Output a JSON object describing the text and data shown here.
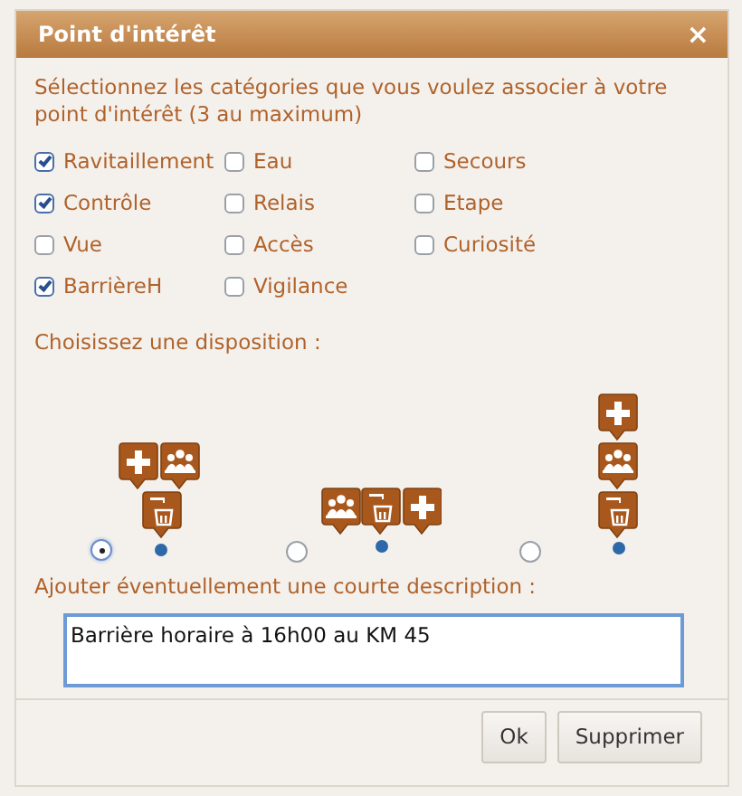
{
  "dialog": {
    "title": "Point d'intérêt",
    "close": "×"
  },
  "intro": "Sélectionnez les catégories que vous voulez associer à votre point d'intérêt (3 au maximum)",
  "categories": [
    {
      "label": "Ravitaillement",
      "checked": true
    },
    {
      "label": "Eau",
      "checked": false
    },
    {
      "label": "Secours",
      "checked": false
    },
    {
      "label": "Contrôle",
      "checked": true
    },
    {
      "label": "Relais",
      "checked": false
    },
    {
      "label": "Etape",
      "checked": false
    },
    {
      "label": "Vue",
      "checked": false
    },
    {
      "label": "Accès",
      "checked": false
    },
    {
      "label": "Curiosité",
      "checked": false
    },
    {
      "label": "BarrièreH",
      "checked": true
    },
    {
      "label": "Vigilance",
      "checked": false
    }
  ],
  "layout_prompt": "Choisissez une disposition :",
  "layouts": [
    {
      "kind": "cluster",
      "selected": true
    },
    {
      "kind": "row",
      "selected": false
    },
    {
      "kind": "column",
      "selected": false
    }
  ],
  "description": {
    "label": "Ajouter éventuellement une courte description :",
    "value": "Barrière horaire à 16h00 au KM 45"
  },
  "buttons": [
    "Ok",
    "Supprimer"
  ]
}
